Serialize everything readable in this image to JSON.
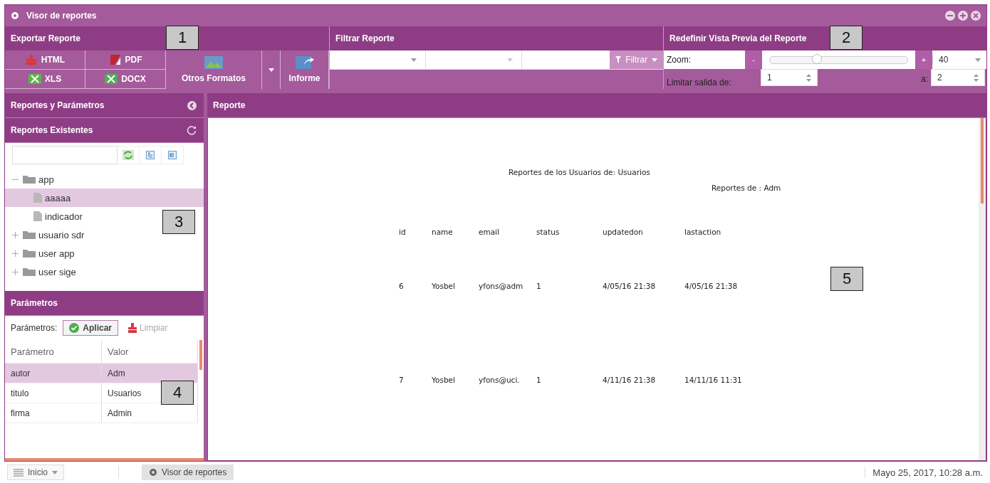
{
  "window": {
    "title": "Visor de reportes"
  },
  "export": {
    "title": "Exportar Reporte",
    "formats": [
      {
        "label": "HTML",
        "kind": "html"
      },
      {
        "label": "PDF",
        "kind": "pdf"
      },
      {
        "label": "XLS",
        "kind": "xls"
      },
      {
        "label": "DOCX",
        "kind": "docx"
      }
    ],
    "other_formats": "Otros Formatos",
    "report_button": "Informe"
  },
  "filter": {
    "title": "Filtrar Reporte",
    "button": "Filtrar"
  },
  "preview": {
    "title": "Redefinir Vista Previa del Reporte",
    "zoom_label": "Zoom:",
    "zoom_minus": "-",
    "zoom_plus": "+",
    "zoom_slider": {
      "level": 0.34
    },
    "zoom_value": "40",
    "limit_label": "Limitar salida de:",
    "from": "1",
    "to_label": "a:",
    "to": "2"
  },
  "sidebar": {
    "title": "Reportes y Parámetros",
    "reports_title": "Reportes Existentes",
    "tree": [
      {
        "label": "app",
        "kind": "folder",
        "expanded": true,
        "selected": false,
        "children": [
          {
            "label": "aaaaa",
            "kind": "file",
            "selected": true
          },
          {
            "label": "indicador",
            "kind": "file",
            "selected": false
          }
        ]
      },
      {
        "label": "usuario sdr",
        "kind": "folder",
        "expanded": false,
        "selected": false
      },
      {
        "label": "user app",
        "kind": "folder",
        "expanded": false,
        "selected": false
      },
      {
        "label": "user sige",
        "kind": "folder",
        "expanded": false,
        "selected": false
      }
    ],
    "params_title": "Parámetros",
    "params_label": "Parámetros:",
    "apply": "Aplicar",
    "clear": "Limpiar",
    "clear_disabled": true,
    "columns": [
      "Parámetro",
      "Valor"
    ],
    "rows": [
      {
        "cells": [
          "autor",
          "Adm"
        ],
        "selected": true
      },
      {
        "cells": [
          "titulo",
          "Usuarios"
        ],
        "selected": false
      },
      {
        "cells": [
          "firma",
          "Admin"
        ],
        "selected": false
      }
    ]
  },
  "report": {
    "title": "Reporte",
    "heading": "Reportes de los Usuarios de: Usuarios",
    "subheading": "Reportes de : Adm",
    "columns": [
      "id",
      "name",
      "email",
      "status",
      "updatedon",
      "lastaction"
    ],
    "rows": [
      [
        "6",
        "Yosbel",
        "yfons@adm",
        "1",
        "4/05/16 21:38",
        "4/05/16 21:38"
      ],
      [
        "7",
        "Yosbel",
        "yfons@uci.",
        "1",
        "4/11/16 21:38",
        "14/11/16 11:31"
      ]
    ]
  },
  "callouts": [
    "1",
    "2",
    "3",
    "5",
    "4"
  ],
  "taskbar": {
    "start": "Inicio",
    "task": "Visor de reportes",
    "clock": "Mayo 25, 2017, 10:28 a.m."
  }
}
